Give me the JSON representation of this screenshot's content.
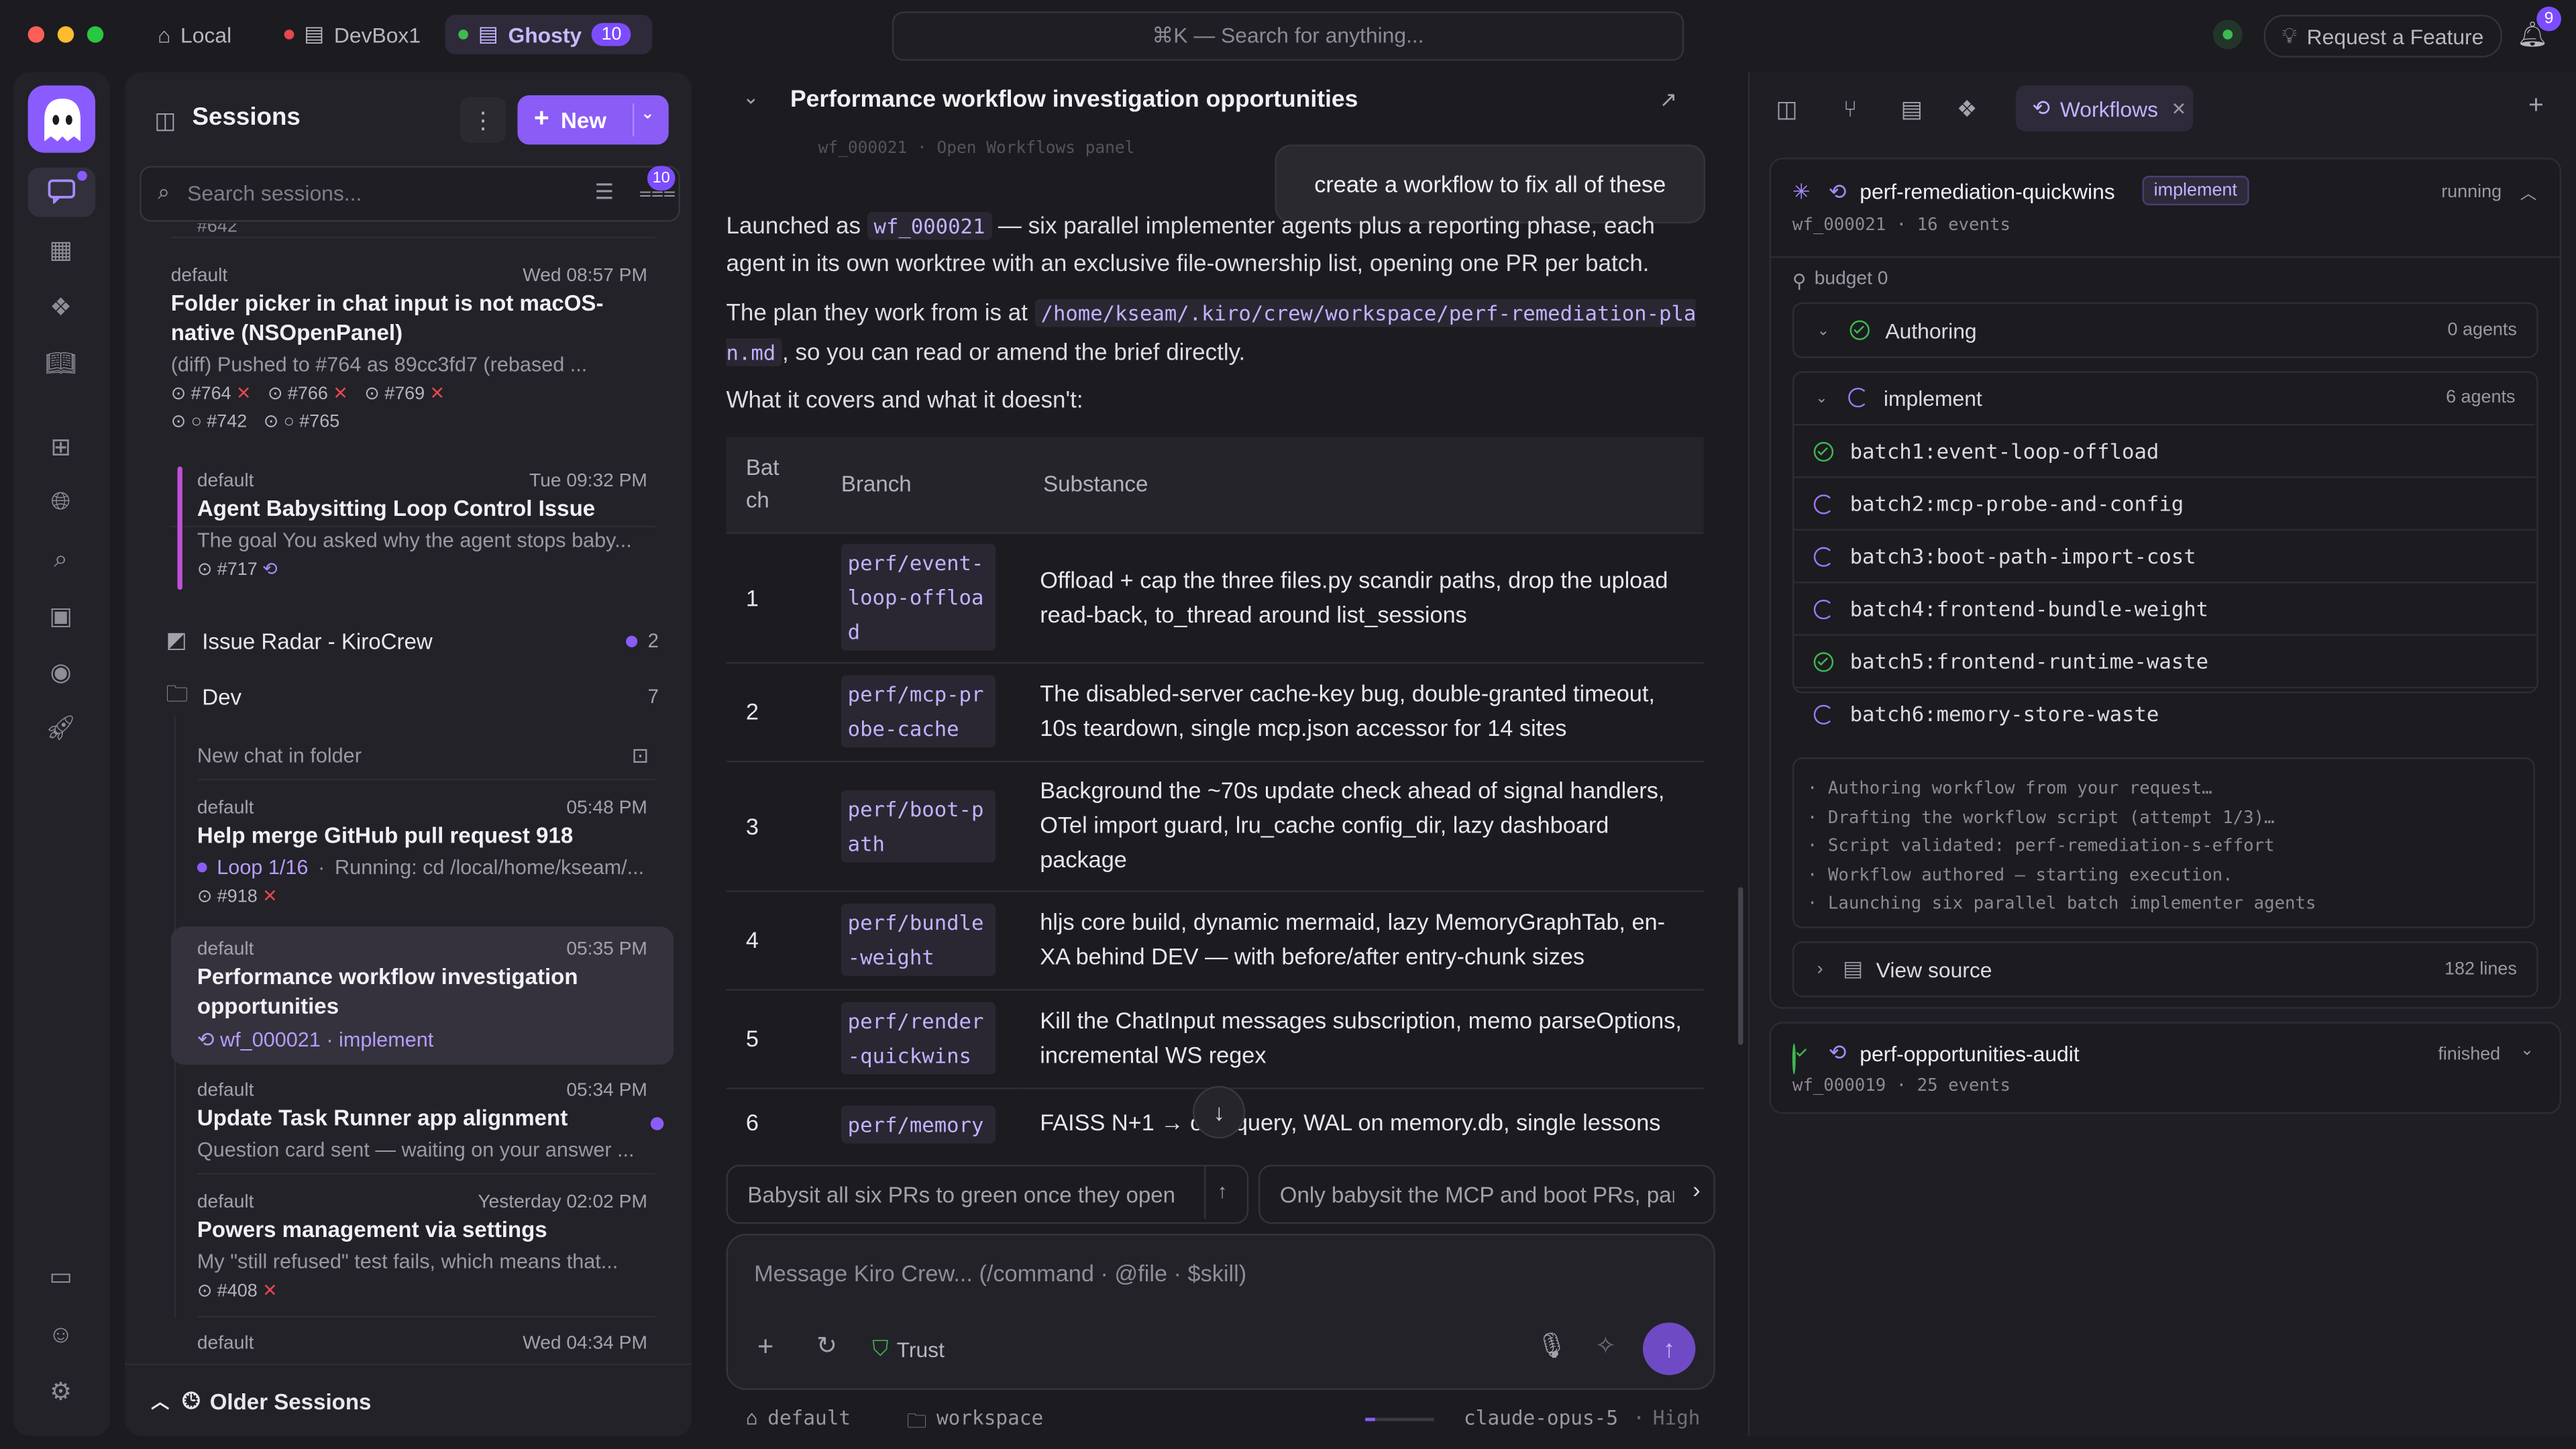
{
  "topbar": {
    "tabs": [
      {
        "label": "Local"
      },
      {
        "label": "DevBox1"
      },
      {
        "label": "Ghosty",
        "badge": "10"
      }
    ],
    "search_placeholder": "⌘K — Search for anything...",
    "request_feature": "Request a Feature",
    "notif_count": "9"
  },
  "sessions": {
    "title": "Sessions",
    "new_label": "New",
    "search_placeholder": "Search sessions...",
    "filter_badge": "10",
    "clipped_pr": "#642",
    "items": [
      {
        "agent": "default",
        "time": "Wed 08:57 PM",
        "title": "Folder picker in chat input is not macOS-native (NSOpenPanel)",
        "sub": "(diff) Pushed to #764 as 89cc3fd7 (rebased ...",
        "prs": [
          "#764",
          "#766",
          "#769"
        ],
        "prs2": [
          "#742",
          "#765"
        ]
      },
      {
        "agent": "default",
        "time": "Tue 09:32 PM",
        "title": "Agent Babysitting Loop Control Issue",
        "sub": "The goal You asked why the agent stops baby...",
        "prs": [
          "#717"
        ]
      },
      {
        "agent": "default",
        "time": "05:48 PM",
        "title": "Help merge GitHub pull request 918",
        "loop": "Loop 1/16",
        "sub": "Running: cd /local/home/kseam/...",
        "prs": [
          "#918"
        ]
      },
      {
        "agent": "default",
        "time": "05:35 PM",
        "title": "Performance workflow investigation opportunities",
        "wf": "wf_000021 · implement"
      },
      {
        "agent": "default",
        "time": "05:34 PM",
        "title": "Update Task Runner app alignment",
        "sub": "Question card sent — waiting on your answer ..."
      },
      {
        "agent": "default",
        "time": "Yesterday 02:02 PM",
        "title": "Powers management via settings",
        "sub": "My \"still refused\" test fails, which means that...",
        "prs": [
          "#408"
        ]
      },
      {
        "agent": "default",
        "time": "Wed 04:34 PM"
      }
    ],
    "folders": [
      {
        "name": "Issue Radar - KiroCrew",
        "count": "2"
      },
      {
        "name": "Dev",
        "count": "7"
      }
    ],
    "new_chat_in_folder": "New chat in folder",
    "older": "Older Sessions"
  },
  "chat": {
    "title": "Performance workflow investigation opportunities",
    "ghost_line": "wf_000021 · Open Workflows panel",
    "user_bubble": "create a workflow to fix all of these",
    "p1_a": "Launched as ",
    "p1_code": "wf_000021",
    "p1_b": " — six parallel implementer agents plus a reporting phase, each agent in its own worktree with an exclusive file-ownership list, opening one PR per batch.",
    "p2_a": "The plan they work from is at ",
    "p2_code": "/home/kseam/.kiro/crew/workspace/perf-remediation-plan.md",
    "p2_b": ", so you can read or amend the brief directly.",
    "p3": "What it covers and what it doesn't:",
    "table_headers": [
      "Batch",
      "Branch",
      "Substance"
    ],
    "rows": [
      {
        "n": "1",
        "branch": "perf/event-loop-offload",
        "substance": "Offload + cap the three files.py scandir paths, drop the upload read-back, to_thread around list_sessions"
      },
      {
        "n": "2",
        "branch": "perf/mcp-probe-cache",
        "substance": "The disabled-server cache-key bug, double-granted timeout, 10s teardown, single mcp.json accessor for 14 sites"
      },
      {
        "n": "3",
        "branch": "perf/boot-path",
        "substance": "Background the ~70s update check ahead of signal handlers, OTel import guard, lru_cache config_dir, lazy dashboard package"
      },
      {
        "n": "4",
        "branch": "perf/bundle-weight",
        "substance": "hljs core build, dynamic mermaid, lazy MemoryGraphTab, en-XA behind DEV — with before/after entry-chunk sizes"
      },
      {
        "n": "5",
        "branch": "perf/render-quickwins",
        "substance": "Kill the ChatInput messages subscription, memo parseOptions, incremental WS regex"
      },
      {
        "n": "6",
        "branch": "perf/memory",
        "substance": "FAISS N+1 → one query, WAL on memory.db, single lessons"
      }
    ],
    "suggestions": [
      "Babysit all six PRs to green once they open",
      "Only babysit the MCP and boot PRs, park the rest"
    ],
    "composer_placeholder": "Message Kiro Crew...  (/command · @file · $skill)",
    "trust": "Trust",
    "footer": {
      "agent": "default",
      "folder": "workspace",
      "model": "claude-opus-5",
      "effort": "High"
    }
  },
  "right": {
    "tab_workflows": "Workflows",
    "wf1": {
      "name": "perf-remediation-quickwins",
      "tag": "implement",
      "status": "running",
      "id": "wf_000021 · 16 events",
      "budget": "budget 0"
    },
    "phases": [
      {
        "name": "Authoring",
        "agents": "0 agents"
      },
      {
        "name": "implement",
        "agents": "6 agents"
      }
    ],
    "batches": [
      {
        "name": "batch1:event-loop-offload",
        "state": "done"
      },
      {
        "name": "batch2:mcp-probe-and-config",
        "state": "running"
      },
      {
        "name": "batch3:boot-path-import-cost",
        "state": "running"
      },
      {
        "name": "batch4:frontend-bundle-weight",
        "state": "running"
      },
      {
        "name": "batch5:frontend-runtime-waste",
        "state": "done"
      },
      {
        "name": "batch6:memory-store-waste",
        "state": "running"
      }
    ],
    "log": [
      "· Authoring workflow from your request…",
      "· Drafting the workflow script (attempt 1/3)…",
      "· Script validated: perf-remediation-s-effort",
      "· Workflow authored — starting execution.",
      "· Launching six parallel batch implementer agents"
    ],
    "view_source": "View source",
    "source_lines": "182 lines",
    "wf2": {
      "name": "perf-opportunities-audit",
      "status": "finished",
      "id": "wf_000019 · 25 events"
    }
  },
  "colors": {
    "accent": "#7c4dff",
    "success": "#3fb950",
    "danger": "#e5484d"
  }
}
